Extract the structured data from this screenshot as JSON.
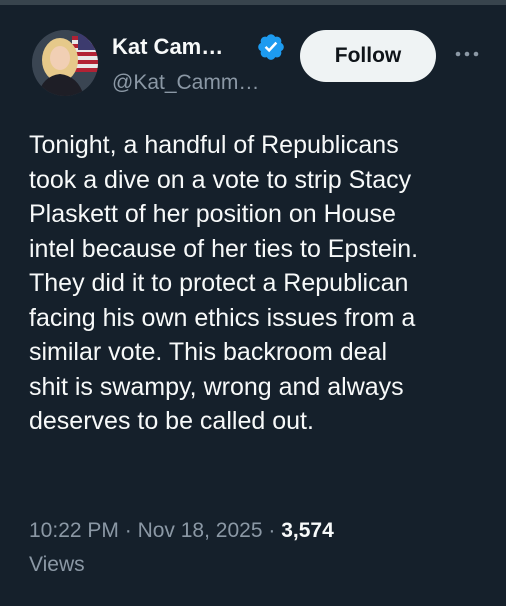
{
  "author": {
    "display_name": "Kat Cam…",
    "handle": "@Kat_Camm…",
    "verified": true,
    "avatar": "avatar-photo"
  },
  "actions": {
    "follow_label": "Follow",
    "more_icon": "ellipsis-icon"
  },
  "tweet": {
    "lines": [
      "Tonight, a handful of Republicans",
      "took a dive on a vote to strip Stacy",
      "Plaskett of her position on House",
      "intel because of her ties to Epstein.",
      "They did it to protect a Republican",
      "facing his own ethics issues from a",
      "similar vote. This backroom deal",
      "shit is swampy, wrong and always",
      "deserves to be called out."
    ]
  },
  "meta": {
    "time": "10:22 PM",
    "separator": "·",
    "date": "Nov 18, 2025",
    "views_count": "3,574",
    "views_label": "Views"
  },
  "colors": {
    "background": "#15202b",
    "text_primary": "#f7f9f9",
    "text_secondary": "#8b98a5",
    "verified_badge": "#1d9bf0",
    "follow_button_bg": "#eff3f4",
    "follow_button_text": "#0f1419"
  }
}
